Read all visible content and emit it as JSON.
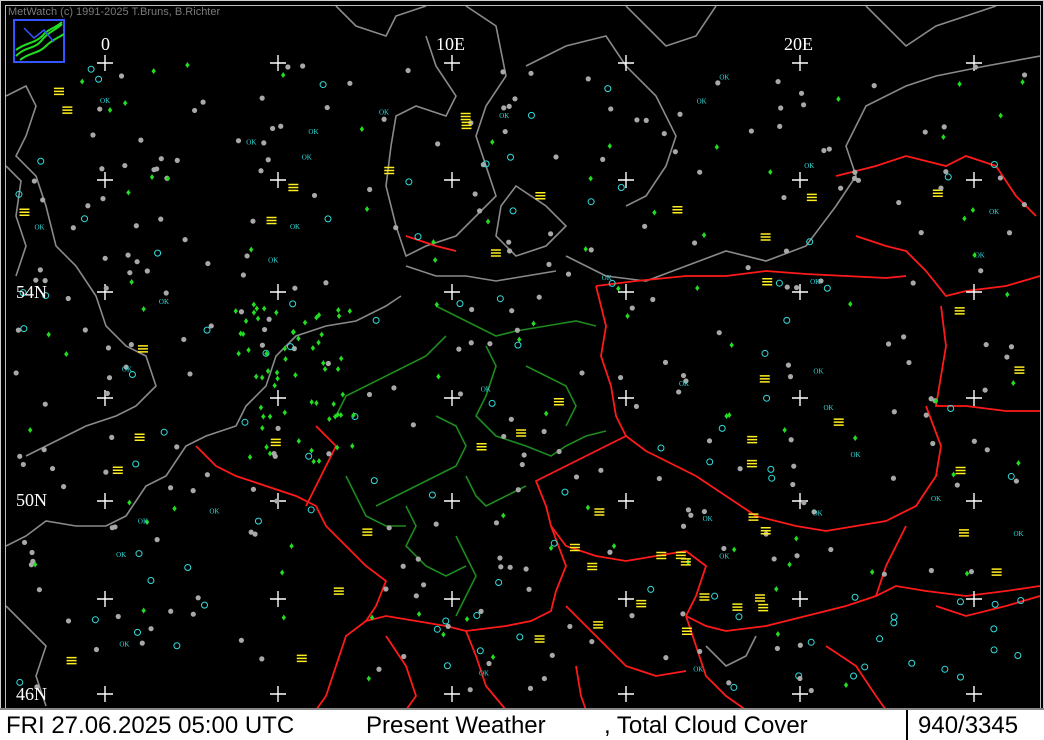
{
  "header": {
    "credit": "MetWatch  (c) 1991-2025 T.Bruns, B.Richter"
  },
  "map": {
    "longitude_labels": [
      "0",
      "10E",
      "20E"
    ],
    "latitude_labels": [
      "54N",
      "50N",
      "46N"
    ],
    "colors": {
      "background": "#000000",
      "coastline": "#8a8a8a",
      "country_border": "#ff1a1a",
      "state_border": "#1f8a1f",
      "grid_cross": "#ffffff",
      "rain_symbol": "#22dd22",
      "clear_sky": "#33dddd",
      "cloudy_station": "#a8a8a8",
      "fog_symbol": "#ffee22"
    },
    "symbol_legend": [
      "OK"
    ]
  },
  "statusbar": {
    "datetime": "FRI 27.06.2025 05:00 UTC",
    "product": "Present Weather",
    "subproduct": ", Total Cloud Cover",
    "counter": "940/3345"
  }
}
